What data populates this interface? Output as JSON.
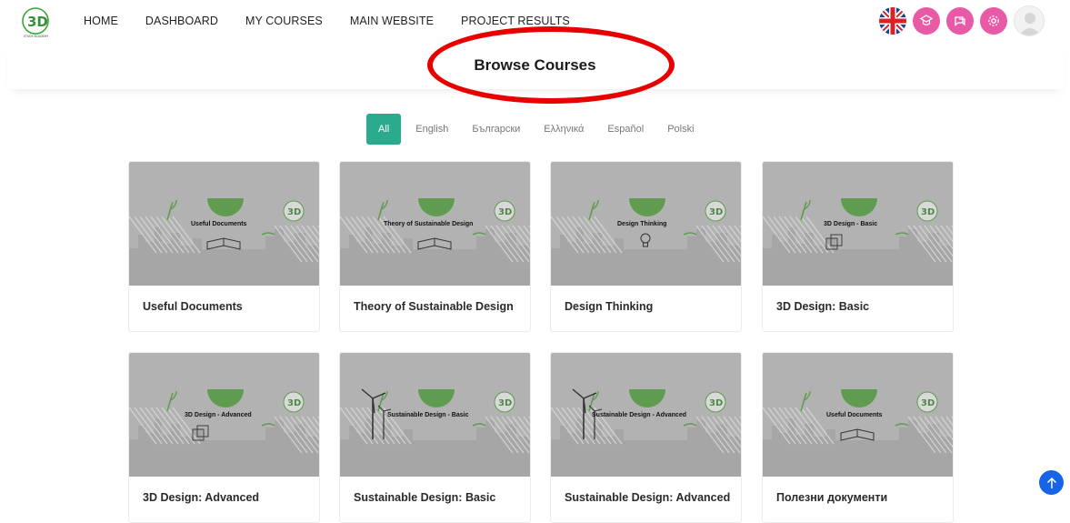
{
  "nav": {
    "logo_text": "3D",
    "logo_sub": "STUDY ACADEMY",
    "links": [
      "HOME",
      "DASHBOARD",
      "MY COURSES",
      "MAIN WEBSITE",
      "PROJECT RESULTS"
    ],
    "icons": [
      "uk-flag-icon",
      "tutor-icon",
      "chat-icon",
      "settings-icon",
      "user-avatar-icon"
    ]
  },
  "page": {
    "title": "Browse Courses"
  },
  "filters": {
    "items": [
      "All",
      "English",
      "Български",
      "Ελληνικά",
      "Español",
      "Polski"
    ],
    "selected": "All"
  },
  "courses": [
    {
      "title": "Useful Documents",
      "thumb_label": "Useful Documents",
      "art": "book"
    },
    {
      "title": "Theory of Sustainable Design",
      "thumb_label": "Theory of Sustainable Design",
      "art": "book"
    },
    {
      "title": "Design Thinking",
      "thumb_label": "Design Thinking",
      "art": "bulb"
    },
    {
      "title": "3D Design: Basic",
      "thumb_label": "3D Design - Basic",
      "art": "cube"
    },
    {
      "title": "3D Design: Advanced",
      "thumb_label": "3D Design - Advanced",
      "art": "cube"
    },
    {
      "title": "Sustainable Design: Basic",
      "thumb_label": "Sustainable Design - Basic",
      "art": "turbine"
    },
    {
      "title": "Sustainable Design: Advanced",
      "thumb_label": "Sustainable Design - Advanced",
      "art": "turbine"
    },
    {
      "title": "Полезни документи",
      "thumb_label": "Useful Documents",
      "art": "book"
    }
  ],
  "colors": {
    "accent": "#2bab8e",
    "pink": "#e85aa6",
    "annotation": "#e80000",
    "scroll_button": "#1764e8",
    "thumb_bg": "#b2b2b2"
  }
}
